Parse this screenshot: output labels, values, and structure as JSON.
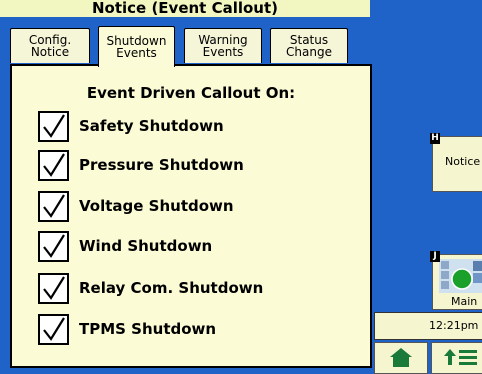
{
  "window": {
    "title": "Notice (Event Callout)"
  },
  "tabs": [
    {
      "line1": "Config.",
      "line2": "Notice"
    },
    {
      "line1": "Shutdown",
      "line2": "Events"
    },
    {
      "line1": "Warning",
      "line2": "Events"
    },
    {
      "line1": "Status",
      "line2": "Change"
    }
  ],
  "panel": {
    "heading": "Event Driven Callout On:",
    "items": [
      {
        "label": "Safety Shutdown",
        "checked": true
      },
      {
        "label": "Pressure Shutdown",
        "checked": true
      },
      {
        "label": "Voltage Shutdown",
        "checked": true
      },
      {
        "label": "Wind Shutdown",
        "checked": true
      },
      {
        "label": "Relay Com. Shutdown",
        "checked": true
      },
      {
        "label": "TPMS Shutdown",
        "checked": true
      }
    ]
  },
  "sidebar": {
    "notice_hotkey": "H",
    "notice_label": "Notice",
    "main_hotkey": "J",
    "main_label": "Main",
    "clock": "12:21pm"
  },
  "colors": {
    "background": "#1f63c9",
    "panel": "#fbfbd6",
    "title_bar": "#f2f6c0"
  }
}
